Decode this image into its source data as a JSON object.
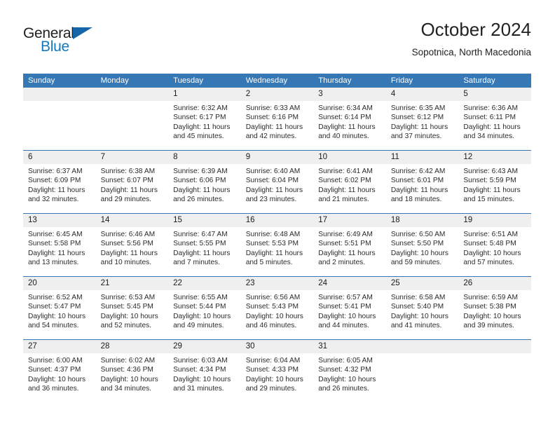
{
  "brand": {
    "name_top": "General",
    "name_bottom": "Blue",
    "accent_color": "#1565a8",
    "blue_text_color": "#1278be"
  },
  "header": {
    "title": "October 2024",
    "subtitle": "Sopotnica, North Macedonia",
    "header_bg_color": "#3578b5",
    "daynum_bg_color": "#efefef"
  },
  "weekday_headers": [
    "Sunday",
    "Monday",
    "Tuesday",
    "Wednesday",
    "Thursday",
    "Friday",
    "Saturday"
  ],
  "labels": {
    "sunrise_prefix": "Sunrise:",
    "sunset_prefix": "Sunset:",
    "daylight_prefix": "Daylight:"
  },
  "weeks": [
    [
      {
        "day": "",
        "empty": true,
        "l1": "",
        "l2": "",
        "l3": "",
        "l4": ""
      },
      {
        "day": "",
        "empty": true,
        "l1": "",
        "l2": "",
        "l3": "",
        "l4": ""
      },
      {
        "day": "1",
        "l1": "Sunrise: 6:32 AM",
        "l2": "Sunset: 6:17 PM",
        "l3": "Daylight: 11 hours",
        "l4": "and 45 minutes."
      },
      {
        "day": "2",
        "l1": "Sunrise: 6:33 AM",
        "l2": "Sunset: 6:16 PM",
        "l3": "Daylight: 11 hours",
        "l4": "and 42 minutes."
      },
      {
        "day": "3",
        "l1": "Sunrise: 6:34 AM",
        "l2": "Sunset: 6:14 PM",
        "l3": "Daylight: 11 hours",
        "l4": "and 40 minutes."
      },
      {
        "day": "4",
        "l1": "Sunrise: 6:35 AM",
        "l2": "Sunset: 6:12 PM",
        "l3": "Daylight: 11 hours",
        "l4": "and 37 minutes."
      },
      {
        "day": "5",
        "l1": "Sunrise: 6:36 AM",
        "l2": "Sunset: 6:11 PM",
        "l3": "Daylight: 11 hours",
        "l4": "and 34 minutes."
      }
    ],
    [
      {
        "day": "6",
        "l1": "Sunrise: 6:37 AM",
        "l2": "Sunset: 6:09 PM",
        "l3": "Daylight: 11 hours",
        "l4": "and 32 minutes."
      },
      {
        "day": "7",
        "l1": "Sunrise: 6:38 AM",
        "l2": "Sunset: 6:07 PM",
        "l3": "Daylight: 11 hours",
        "l4": "and 29 minutes."
      },
      {
        "day": "8",
        "l1": "Sunrise: 6:39 AM",
        "l2": "Sunset: 6:06 PM",
        "l3": "Daylight: 11 hours",
        "l4": "and 26 minutes."
      },
      {
        "day": "9",
        "l1": "Sunrise: 6:40 AM",
        "l2": "Sunset: 6:04 PM",
        "l3": "Daylight: 11 hours",
        "l4": "and 23 minutes."
      },
      {
        "day": "10",
        "l1": "Sunrise: 6:41 AM",
        "l2": "Sunset: 6:02 PM",
        "l3": "Daylight: 11 hours",
        "l4": "and 21 minutes."
      },
      {
        "day": "11",
        "l1": "Sunrise: 6:42 AM",
        "l2": "Sunset: 6:01 PM",
        "l3": "Daylight: 11 hours",
        "l4": "and 18 minutes."
      },
      {
        "day": "12",
        "l1": "Sunrise: 6:43 AM",
        "l2": "Sunset: 5:59 PM",
        "l3": "Daylight: 11 hours",
        "l4": "and 15 minutes."
      }
    ],
    [
      {
        "day": "13",
        "l1": "Sunrise: 6:45 AM",
        "l2": "Sunset: 5:58 PM",
        "l3": "Daylight: 11 hours",
        "l4": "and 13 minutes."
      },
      {
        "day": "14",
        "l1": "Sunrise: 6:46 AM",
        "l2": "Sunset: 5:56 PM",
        "l3": "Daylight: 11 hours",
        "l4": "and 10 minutes."
      },
      {
        "day": "15",
        "l1": "Sunrise: 6:47 AM",
        "l2": "Sunset: 5:55 PM",
        "l3": "Daylight: 11 hours",
        "l4": "and 7 minutes."
      },
      {
        "day": "16",
        "l1": "Sunrise: 6:48 AM",
        "l2": "Sunset: 5:53 PM",
        "l3": "Daylight: 11 hours",
        "l4": "and 5 minutes."
      },
      {
        "day": "17",
        "l1": "Sunrise: 6:49 AM",
        "l2": "Sunset: 5:51 PM",
        "l3": "Daylight: 11 hours",
        "l4": "and 2 minutes."
      },
      {
        "day": "18",
        "l1": "Sunrise: 6:50 AM",
        "l2": "Sunset: 5:50 PM",
        "l3": "Daylight: 10 hours",
        "l4": "and 59 minutes."
      },
      {
        "day": "19",
        "l1": "Sunrise: 6:51 AM",
        "l2": "Sunset: 5:48 PM",
        "l3": "Daylight: 10 hours",
        "l4": "and 57 minutes."
      }
    ],
    [
      {
        "day": "20",
        "l1": "Sunrise: 6:52 AM",
        "l2": "Sunset: 5:47 PM",
        "l3": "Daylight: 10 hours",
        "l4": "and 54 minutes."
      },
      {
        "day": "21",
        "l1": "Sunrise: 6:53 AM",
        "l2": "Sunset: 5:45 PM",
        "l3": "Daylight: 10 hours",
        "l4": "and 52 minutes."
      },
      {
        "day": "22",
        "l1": "Sunrise: 6:55 AM",
        "l2": "Sunset: 5:44 PM",
        "l3": "Daylight: 10 hours",
        "l4": "and 49 minutes."
      },
      {
        "day": "23",
        "l1": "Sunrise: 6:56 AM",
        "l2": "Sunset: 5:43 PM",
        "l3": "Daylight: 10 hours",
        "l4": "and 46 minutes."
      },
      {
        "day": "24",
        "l1": "Sunrise: 6:57 AM",
        "l2": "Sunset: 5:41 PM",
        "l3": "Daylight: 10 hours",
        "l4": "and 44 minutes."
      },
      {
        "day": "25",
        "l1": "Sunrise: 6:58 AM",
        "l2": "Sunset: 5:40 PM",
        "l3": "Daylight: 10 hours",
        "l4": "and 41 minutes."
      },
      {
        "day": "26",
        "l1": "Sunrise: 6:59 AM",
        "l2": "Sunset: 5:38 PM",
        "l3": "Daylight: 10 hours",
        "l4": "and 39 minutes."
      }
    ],
    [
      {
        "day": "27",
        "l1": "Sunrise: 6:00 AM",
        "l2": "Sunset: 4:37 PM",
        "l3": "Daylight: 10 hours",
        "l4": "and 36 minutes."
      },
      {
        "day": "28",
        "l1": "Sunrise: 6:02 AM",
        "l2": "Sunset: 4:36 PM",
        "l3": "Daylight: 10 hours",
        "l4": "and 34 minutes."
      },
      {
        "day": "29",
        "l1": "Sunrise: 6:03 AM",
        "l2": "Sunset: 4:34 PM",
        "l3": "Daylight: 10 hours",
        "l4": "and 31 minutes."
      },
      {
        "day": "30",
        "l1": "Sunrise: 6:04 AM",
        "l2": "Sunset: 4:33 PM",
        "l3": "Daylight: 10 hours",
        "l4": "and 29 minutes."
      },
      {
        "day": "31",
        "l1": "Sunrise: 6:05 AM",
        "l2": "Sunset: 4:32 PM",
        "l3": "Daylight: 10 hours",
        "l4": "and 26 minutes."
      },
      {
        "day": "",
        "empty": true,
        "l1": "",
        "l2": "",
        "l3": "",
        "l4": ""
      },
      {
        "day": "",
        "empty": true,
        "l1": "",
        "l2": "",
        "l3": "",
        "l4": ""
      }
    ]
  ]
}
